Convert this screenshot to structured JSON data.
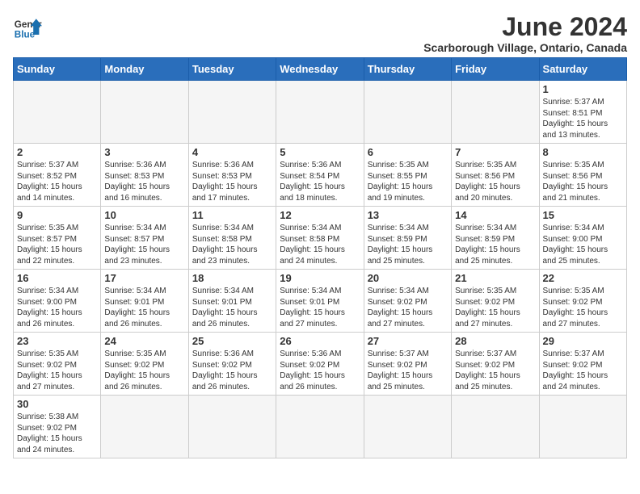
{
  "header": {
    "logo_general": "General",
    "logo_blue": "Blue",
    "month_year": "June 2024",
    "location": "Scarborough Village, Ontario, Canada"
  },
  "weekdays": [
    "Sunday",
    "Monday",
    "Tuesday",
    "Wednesday",
    "Thursday",
    "Friday",
    "Saturday"
  ],
  "days": [
    {
      "num": "",
      "info": ""
    },
    {
      "num": "",
      "info": ""
    },
    {
      "num": "",
      "info": ""
    },
    {
      "num": "",
      "info": ""
    },
    {
      "num": "",
      "info": ""
    },
    {
      "num": "",
      "info": ""
    },
    {
      "num": "1",
      "info": "Sunrise: 5:37 AM\nSunset: 8:51 PM\nDaylight: 15 hours and 13 minutes."
    },
    {
      "num": "2",
      "info": "Sunrise: 5:37 AM\nSunset: 8:52 PM\nDaylight: 15 hours and 14 minutes."
    },
    {
      "num": "3",
      "info": "Sunrise: 5:36 AM\nSunset: 8:53 PM\nDaylight: 15 hours and 16 minutes."
    },
    {
      "num": "4",
      "info": "Sunrise: 5:36 AM\nSunset: 8:53 PM\nDaylight: 15 hours and 17 minutes."
    },
    {
      "num": "5",
      "info": "Sunrise: 5:36 AM\nSunset: 8:54 PM\nDaylight: 15 hours and 18 minutes."
    },
    {
      "num": "6",
      "info": "Sunrise: 5:35 AM\nSunset: 8:55 PM\nDaylight: 15 hours and 19 minutes."
    },
    {
      "num": "7",
      "info": "Sunrise: 5:35 AM\nSunset: 8:56 PM\nDaylight: 15 hours and 20 minutes."
    },
    {
      "num": "8",
      "info": "Sunrise: 5:35 AM\nSunset: 8:56 PM\nDaylight: 15 hours and 21 minutes."
    },
    {
      "num": "9",
      "info": "Sunrise: 5:35 AM\nSunset: 8:57 PM\nDaylight: 15 hours and 22 minutes."
    },
    {
      "num": "10",
      "info": "Sunrise: 5:34 AM\nSunset: 8:57 PM\nDaylight: 15 hours and 23 minutes."
    },
    {
      "num": "11",
      "info": "Sunrise: 5:34 AM\nSunset: 8:58 PM\nDaylight: 15 hours and 23 minutes."
    },
    {
      "num": "12",
      "info": "Sunrise: 5:34 AM\nSunset: 8:58 PM\nDaylight: 15 hours and 24 minutes."
    },
    {
      "num": "13",
      "info": "Sunrise: 5:34 AM\nSunset: 8:59 PM\nDaylight: 15 hours and 25 minutes."
    },
    {
      "num": "14",
      "info": "Sunrise: 5:34 AM\nSunset: 8:59 PM\nDaylight: 15 hours and 25 minutes."
    },
    {
      "num": "15",
      "info": "Sunrise: 5:34 AM\nSunset: 9:00 PM\nDaylight: 15 hours and 25 minutes."
    },
    {
      "num": "16",
      "info": "Sunrise: 5:34 AM\nSunset: 9:00 PM\nDaylight: 15 hours and 26 minutes."
    },
    {
      "num": "17",
      "info": "Sunrise: 5:34 AM\nSunset: 9:01 PM\nDaylight: 15 hours and 26 minutes."
    },
    {
      "num": "18",
      "info": "Sunrise: 5:34 AM\nSunset: 9:01 PM\nDaylight: 15 hours and 26 minutes."
    },
    {
      "num": "19",
      "info": "Sunrise: 5:34 AM\nSunset: 9:01 PM\nDaylight: 15 hours and 27 minutes."
    },
    {
      "num": "20",
      "info": "Sunrise: 5:34 AM\nSunset: 9:02 PM\nDaylight: 15 hours and 27 minutes."
    },
    {
      "num": "21",
      "info": "Sunrise: 5:35 AM\nSunset: 9:02 PM\nDaylight: 15 hours and 27 minutes."
    },
    {
      "num": "22",
      "info": "Sunrise: 5:35 AM\nSunset: 9:02 PM\nDaylight: 15 hours and 27 minutes."
    },
    {
      "num": "23",
      "info": "Sunrise: 5:35 AM\nSunset: 9:02 PM\nDaylight: 15 hours and 27 minutes."
    },
    {
      "num": "24",
      "info": "Sunrise: 5:35 AM\nSunset: 9:02 PM\nDaylight: 15 hours and 26 minutes."
    },
    {
      "num": "25",
      "info": "Sunrise: 5:36 AM\nSunset: 9:02 PM\nDaylight: 15 hours and 26 minutes."
    },
    {
      "num": "26",
      "info": "Sunrise: 5:36 AM\nSunset: 9:02 PM\nDaylight: 15 hours and 26 minutes."
    },
    {
      "num": "27",
      "info": "Sunrise: 5:37 AM\nSunset: 9:02 PM\nDaylight: 15 hours and 25 minutes."
    },
    {
      "num": "28",
      "info": "Sunrise: 5:37 AM\nSunset: 9:02 PM\nDaylight: 15 hours and 25 minutes."
    },
    {
      "num": "29",
      "info": "Sunrise: 5:37 AM\nSunset: 9:02 PM\nDaylight: 15 hours and 24 minutes."
    },
    {
      "num": "30",
      "info": "Sunrise: 5:38 AM\nSunset: 9:02 PM\nDaylight: 15 hours and 24 minutes."
    },
    {
      "num": "",
      "info": ""
    },
    {
      "num": "",
      "info": ""
    },
    {
      "num": "",
      "info": ""
    },
    {
      "num": "",
      "info": ""
    },
    {
      "num": "",
      "info": ""
    },
    {
      "num": "",
      "info": ""
    }
  ]
}
